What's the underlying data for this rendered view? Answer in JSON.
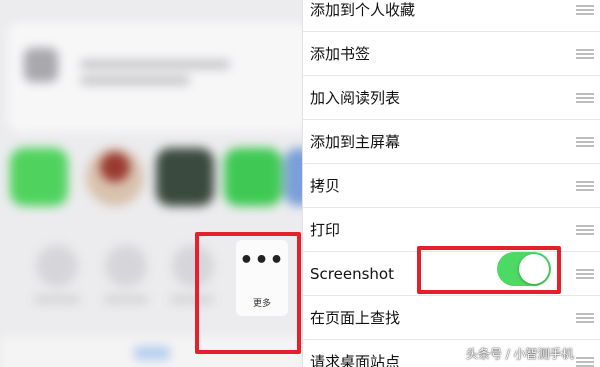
{
  "more_button": {
    "icon": "more-dots-icon",
    "dots": "•••",
    "label": "更多"
  },
  "settings": {
    "rows": [
      {
        "label": "添加到个人收藏"
      },
      {
        "label": "添加书签"
      },
      {
        "label": "加入阅读列表"
      },
      {
        "label": "添加到主屏幕"
      },
      {
        "label": "拷贝"
      },
      {
        "label": "打印"
      },
      {
        "label": "Screenshot",
        "toggle": true,
        "toggle_on": true
      },
      {
        "label": "在页面上查找"
      },
      {
        "label": "请求桌面站点"
      }
    ]
  },
  "colors": {
    "toggle_on": "#4cd964",
    "highlight": "#e5202a"
  },
  "watermark": "头条号 / 小智测手机"
}
